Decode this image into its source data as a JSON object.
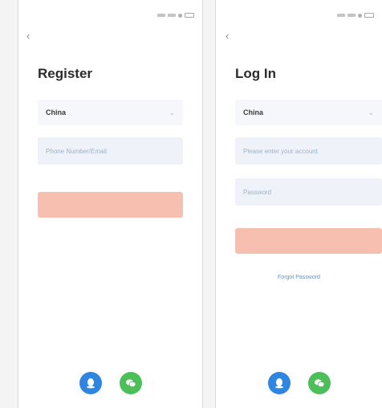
{
  "register": {
    "status_time": "",
    "title": "Register",
    "region": "China",
    "account_placeholder": "Phone Number/Email",
    "submit_label": "",
    "social": [
      {
        "icon": "qq-icon",
        "color": "#2f86e0"
      },
      {
        "icon": "wechat-icon",
        "color": "#4cbf58"
      }
    ]
  },
  "login": {
    "status_time": "",
    "title": "Log In",
    "region": "China",
    "account_placeholder": "Please enter your account",
    "password_placeholder": "Password",
    "submit_label": "",
    "forgot_password": "Forgot Password",
    "social": [
      {
        "icon": "qq-icon",
        "color": "#2f86e0"
      },
      {
        "icon": "wechat-icon",
        "color": "#4cbf58"
      }
    ]
  },
  "colors": {
    "accent_button": "#f7bfb0",
    "input_bg": "#eff3f9",
    "link": "#5b8fd6"
  }
}
